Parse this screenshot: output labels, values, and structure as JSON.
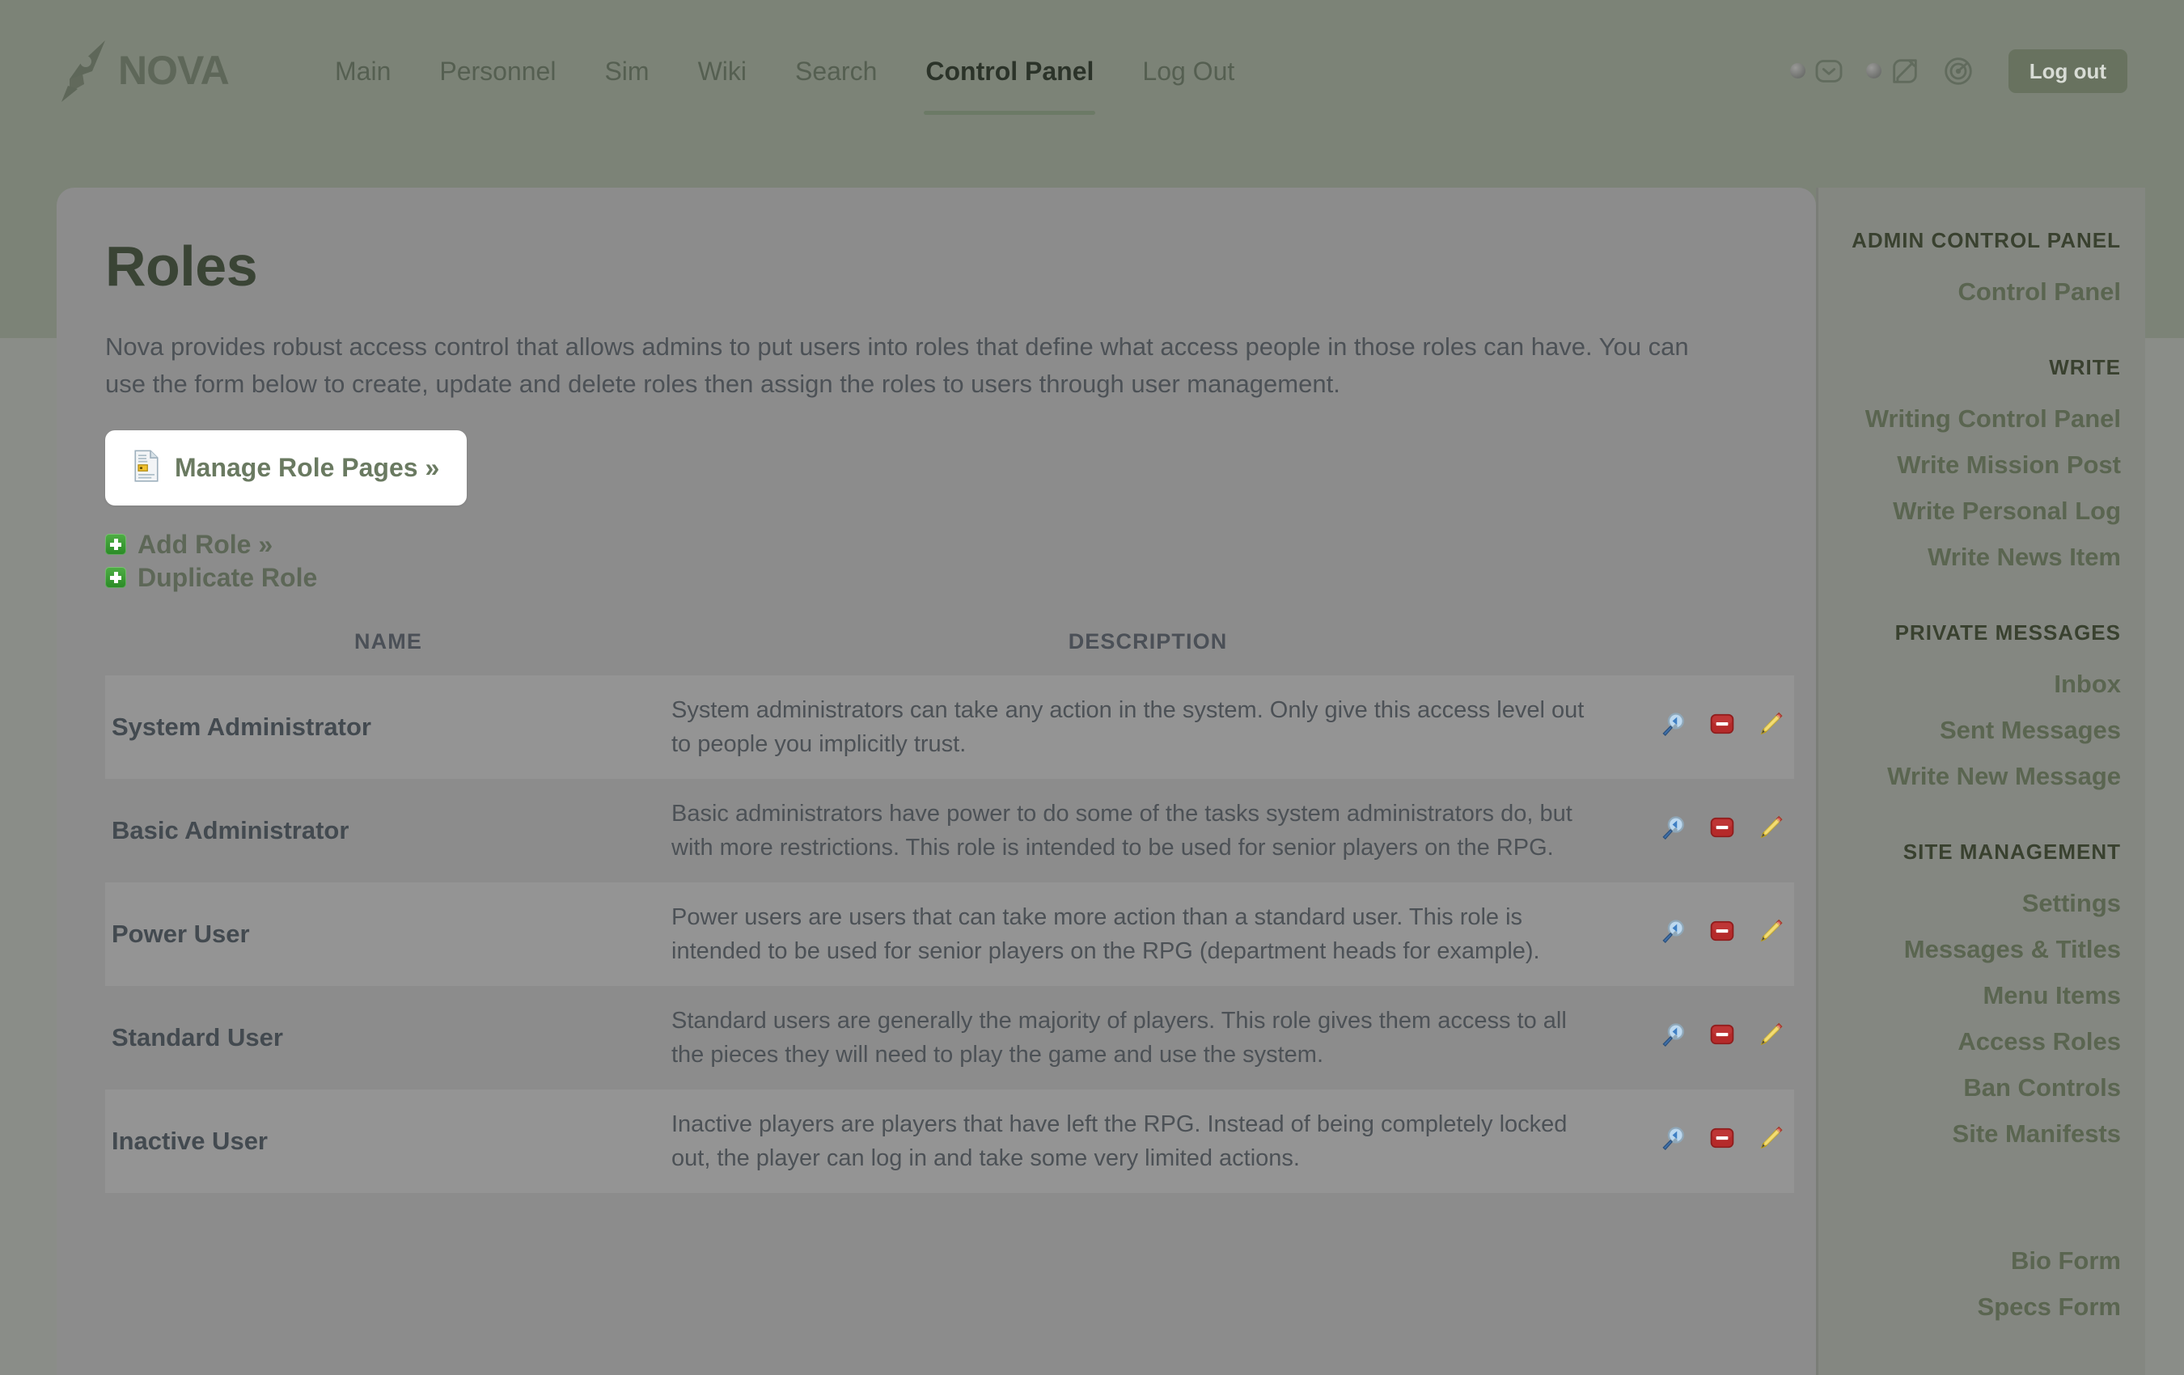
{
  "header": {
    "brand": "NOVA",
    "brand_icon": "pen-nib-icon",
    "nav": [
      {
        "label": "Main",
        "active": false
      },
      {
        "label": "Personnel",
        "active": false
      },
      {
        "label": "Sim",
        "active": false
      },
      {
        "label": "Wiki",
        "active": false
      },
      {
        "label": "Search",
        "active": false
      },
      {
        "label": "Control Panel",
        "active": true
      },
      {
        "label": "Log Out",
        "active": false
      }
    ],
    "icons": [
      {
        "name": "envelope-icon",
        "has_dot": true
      },
      {
        "name": "pencil-square-icon",
        "has_dot": true
      },
      {
        "name": "gauge-icon",
        "has_dot": false
      }
    ],
    "logout_label": "Log out"
  },
  "main": {
    "title": "Roles",
    "intro": "Nova provides robust access control that allows admins to put users into roles that define what access people in those roles can have. You can use the form below to create, update and delete roles then assign the roles to users through user management.",
    "manage_button": {
      "label": "Manage Role Pages »",
      "icon": "document-icon"
    },
    "add_links": [
      {
        "label": "Add Role »",
        "icon": "plus-icon"
      },
      {
        "label": "Duplicate Role",
        "icon": "plus-icon"
      }
    ],
    "table": {
      "columns": [
        "NAME",
        "DESCRIPTION",
        ""
      ],
      "row_actions": [
        {
          "name": "view-permissions-icon",
          "title": "magnifier"
        },
        {
          "name": "delete-icon",
          "title": "red-minus"
        },
        {
          "name": "edit-icon",
          "title": "pencil"
        }
      ],
      "rows": [
        {
          "name": "System Administrator",
          "description": "System administrators can take any action in the system. Only give this access level out to people you implicitly trust."
        },
        {
          "name": "Basic Administrator",
          "description": "Basic administrators have power to do some of the tasks system administrators do, but with more restrictions. This role is intended to be used for senior players on the RPG."
        },
        {
          "name": "Power User",
          "description": "Power users are users that can take more action than a standard user. This role is intended to be used for senior players on the RPG (department heads for example)."
        },
        {
          "name": "Standard User",
          "description": "Standard users are generally the majority of players. This role gives them access to all the pieces they will need to play the game and use the system."
        },
        {
          "name": "Inactive User",
          "description": "Inactive players are players that have left the RPG. Instead of being completely locked out, the player can log in and take some very limited actions."
        }
      ]
    }
  },
  "sidebar": {
    "groups": [
      {
        "heading": "ADMIN CONTROL PANEL",
        "items": [
          {
            "label": "Control Panel"
          }
        ]
      },
      {
        "heading": "WRITE",
        "items": [
          {
            "label": "Writing Control Panel"
          },
          {
            "label": "Write Mission Post"
          },
          {
            "label": "Write Personal Log"
          },
          {
            "label": "Write News Item"
          }
        ]
      },
      {
        "heading": "PRIVATE MESSAGES",
        "items": [
          {
            "label": "Inbox"
          },
          {
            "label": "Sent Messages"
          },
          {
            "label": "Write New Message"
          }
        ]
      },
      {
        "heading": "SITE MANAGEMENT",
        "items": [
          {
            "label": "Settings"
          },
          {
            "label": "Messages & Titles"
          },
          {
            "label": "Menu Items"
          },
          {
            "label": "Access Roles"
          },
          {
            "label": "Ban Controls"
          },
          {
            "label": "Site Manifests"
          }
        ]
      },
      {
        "heading": "",
        "items": [
          {
            "label": "Bio Form"
          },
          {
            "label": "Specs Form"
          }
        ]
      }
    ]
  },
  "colors": {
    "brand_green": "#7c8377",
    "accent_green": "#6a7a61",
    "title_green": "#3a4435",
    "card_bg": "#8c8c8c",
    "delete_red": "#b52a2a"
  }
}
